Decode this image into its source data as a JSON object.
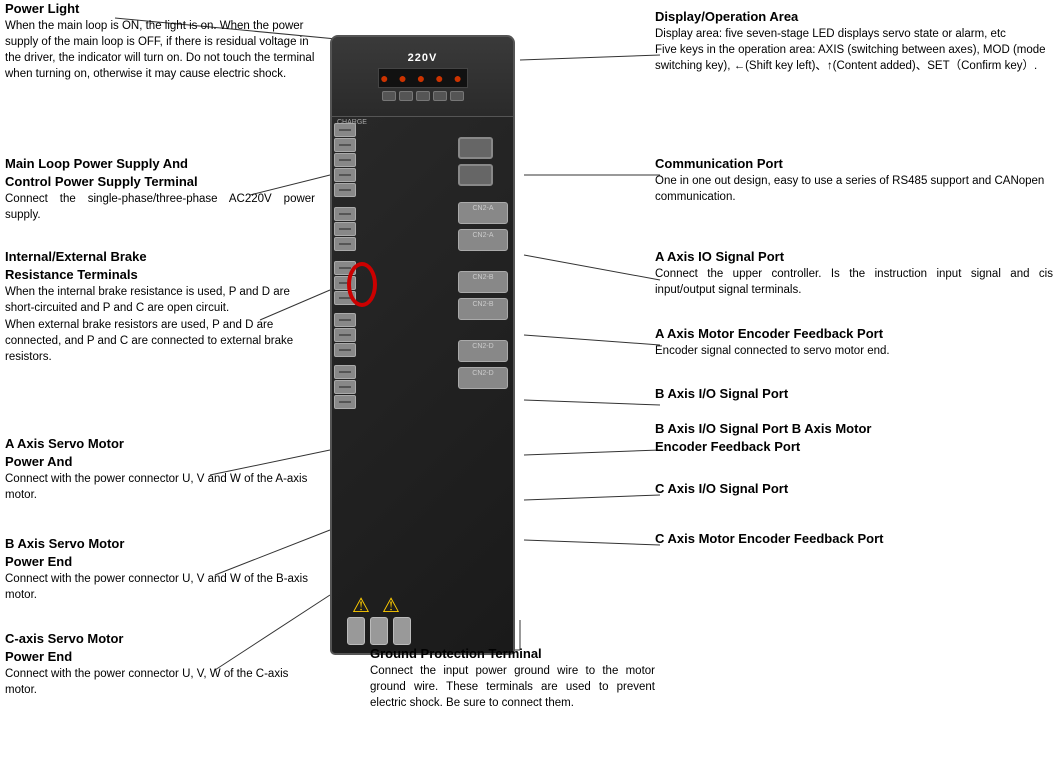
{
  "annotations": {
    "power_light": {
      "title": "Power Light",
      "body": "When the main loop is ON, the light is on. When the power supply of the main loop is OFF, if there is residual voltage in the driver, the indicator will turn on. Do not touch the terminal when turning on, otherwise it may cause electric shock."
    },
    "main_loop": {
      "title": "Main Loop Power Supply And\nControl Power Supply Terminal",
      "body": "Connect  the  single-phase/three-phase AC220V power supply."
    },
    "brake": {
      "title": "Internal/External Brake\nResistance Terminals",
      "body": "When the internal brake resistance is used, P and D are short-circuited and P and C are open circuit.\nWhen external brake resistors are used, P and D are connected, and P and C are connected to external brake resistors."
    },
    "a_axis_servo": {
      "title": "A Axis Servo Motor\nPower And",
      "body": "Connect with the power connector U, V and W of the A-axis motor."
    },
    "b_axis_servo": {
      "title": "B Axis Servo Motor\nPower End",
      "body": "Connect with the power connector U, V and W of the B-axis motor."
    },
    "c_axis_servo": {
      "title": "C-axis Servo Motor\nPower End",
      "body": "Connect with the power connector U, V, W of the C-axis motor."
    },
    "display_operation": {
      "title": "Display/Operation Area",
      "body": "Display area: five seven-stage LED displays servo state or alarm, etc\nFive keys in the operation area: AXIS (switching between axes), MOD (mode switching key), ←(Shift key left)、↑(Content added)、SET（Confirm key）."
    },
    "communication_port": {
      "title": "Communication Port",
      "body": "One in one out design, easy to use a series of RS485 support and CANopen communication."
    },
    "a_axis_io": {
      "title": "A Axis IO Signal Port",
      "body": "Connect the upper controller. Is the instruction input signal and cis input/output signal terminals."
    },
    "a_axis_encoder": {
      "title": "A Axis Motor Encoder Feedback Port",
      "body": "Encoder signal connected to servo motor end."
    },
    "b_axis_io": {
      "title": "B Axis I/O Signal Port",
      "body": ""
    },
    "b_axis_io_encoder": {
      "title": "B Axis I/O Signal Port B Axis Motor\nEncoder Feedback Port",
      "body": ""
    },
    "c_axis_io": {
      "title": "C Axis I/O Signal Port",
      "body": ""
    },
    "c_axis_encoder": {
      "title": "C Axis Motor Encoder Feedback Port",
      "body": ""
    },
    "ground_protection": {
      "title": "Ground Protection Terminal",
      "body": "Connect the input power ground wire to the motor ground wire. These terminals are used to prevent electric shock. Be sure to connect them."
    }
  },
  "device": {
    "voltage_label": "220V",
    "charge_label": "CHARGE"
  }
}
